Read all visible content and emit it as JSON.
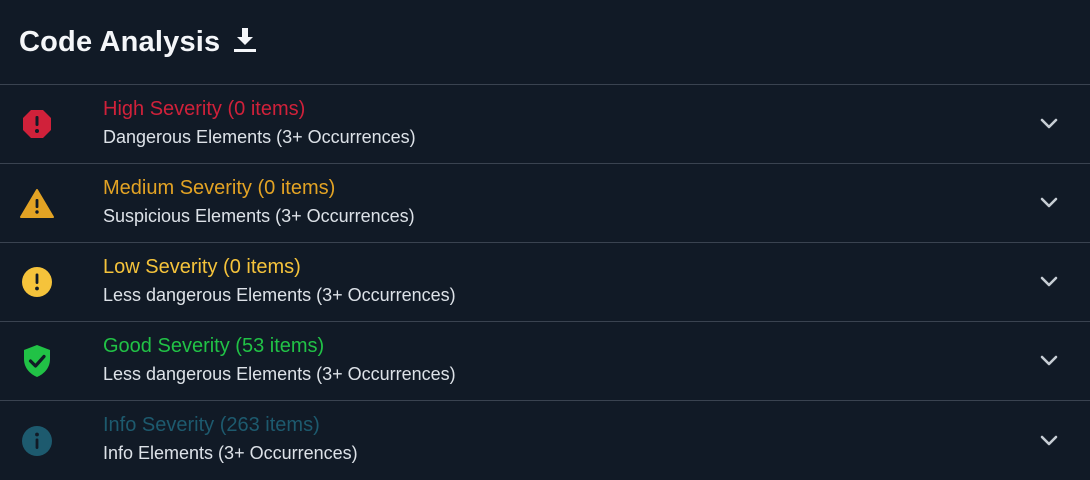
{
  "header": {
    "title": "Code Analysis",
    "download_icon": "download-icon"
  },
  "severities": [
    {
      "title": "High Severity (0 items)",
      "subtitle": "Dangerous Elements (3+ Occurrences)",
      "color": "#d0213a",
      "icon": "octagon-alert-icon"
    },
    {
      "title": "Medium Severity (0 items)",
      "subtitle": "Suspicious Elements (3+ Occurrences)",
      "color": "#e3a324",
      "icon": "warning-triangle-icon"
    },
    {
      "title": "Low Severity (0 items)",
      "subtitle": "Less dangerous Elements (3+ Occurrences)",
      "color": "#f5c33b",
      "icon": "exclamation-circle-icon"
    },
    {
      "title": "Good Severity (53 items)",
      "subtitle": "Less dangerous Elements (3+ Occurrences)",
      "color": "#21c246",
      "icon": "shield-check-icon"
    },
    {
      "title": "Info Severity (263 items)",
      "subtitle": "Info Elements (3+ Occurrences)",
      "color": "#1d5a6e",
      "icon": "info-circle-icon"
    }
  ],
  "colors": {
    "background": "#111a26",
    "divider": "#3a4350",
    "chevron": "#c7cdd4"
  }
}
